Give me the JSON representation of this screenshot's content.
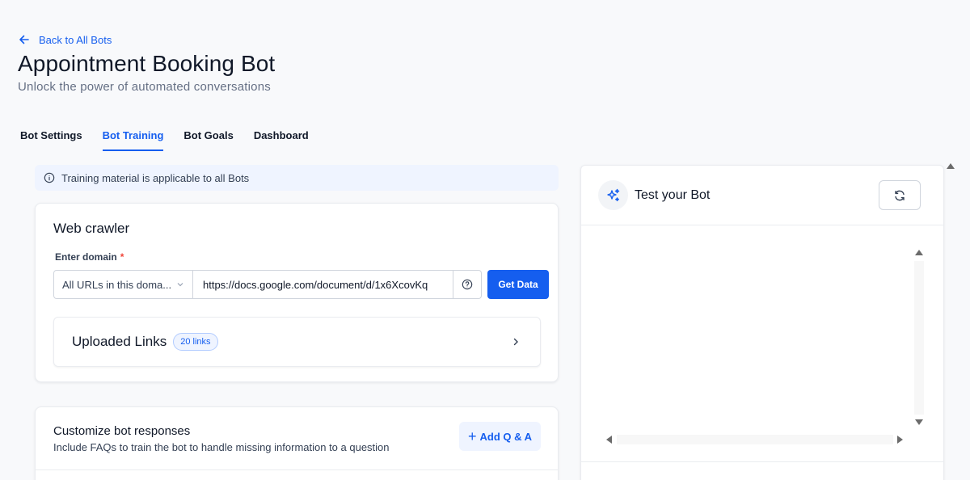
{
  "header": {
    "back_label": "Back to All Bots",
    "title": "Appointment Booking Bot",
    "subtitle": "Unlock the power of automated conversations"
  },
  "tabs": [
    {
      "label": "Bot Settings",
      "active": false
    },
    {
      "label": "Bot Training",
      "active": true
    },
    {
      "label": "Bot Goals",
      "active": false
    },
    {
      "label": "Dashboard",
      "active": false
    }
  ],
  "notice": {
    "icon": "info-icon",
    "text": "Training material is applicable to all Bots"
  },
  "web_crawler": {
    "title": "Web crawler",
    "domain_label": "Enter domain",
    "required_mark": "*",
    "scope_select": "All URLs in this doma...",
    "url_value": "https://docs.google.com/document/d/1x6XcovKq",
    "get_data_label": "Get Data",
    "uploaded_links_title": "Uploaded Links",
    "uploaded_links_badge": "20 links"
  },
  "customize": {
    "title": "Customize bot responses",
    "description": "Include FAQs to train the bot to handle missing information to a question",
    "add_qa_icon": "+",
    "add_qa_label": "Add Q & A"
  },
  "test_bot": {
    "title": "Test your Bot",
    "icon": "sparkle-icon",
    "refresh_icon": "refresh-icon"
  },
  "colors": {
    "accent": "#155eef",
    "required": "#f04438",
    "badge_bg": "#eff4ff"
  }
}
